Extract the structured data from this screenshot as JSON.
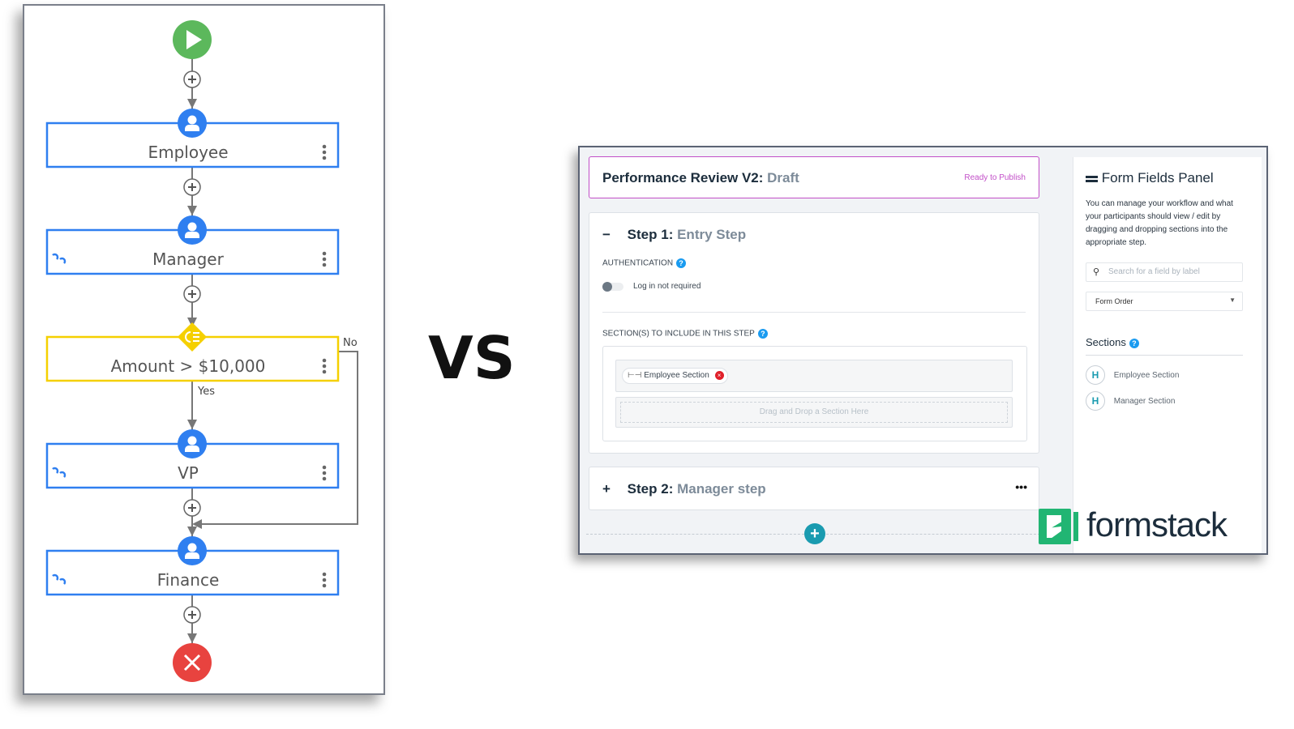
{
  "workflow": {
    "nodes": [
      {
        "label": "Employee",
        "type": "person",
        "linked": false
      },
      {
        "label": "Manager",
        "type": "person",
        "linked": true
      },
      {
        "label": "Amount > $10,000",
        "type": "condition",
        "linked": false
      },
      {
        "label": "VP",
        "type": "person",
        "linked": true
      },
      {
        "label": "Finance",
        "type": "person",
        "linked": true
      }
    ],
    "yes_label": "Yes",
    "no_label": "No",
    "colors": {
      "start": "#5cb85c",
      "end": "#e8433f",
      "person": "#2f7ff0",
      "condition": "#f5d000",
      "line": "#777777"
    }
  },
  "vs_label": "VS",
  "formstack": {
    "header": {
      "title": "Performance Review V2:",
      "status": "Draft",
      "publish_label": "Ready to Publish"
    },
    "step1": {
      "toggle_icon": "−",
      "title": "Step 1:",
      "name": "Entry Step",
      "auth_label": "AUTHENTICATION",
      "auth_value": "Log in not required",
      "sections_label": "SECTION(S) TO INCLUDE IN THIS STEP",
      "section_chip": "Employee Section",
      "drop_placeholder": "Drag and Drop a Section Here"
    },
    "step2": {
      "toggle_icon": "+",
      "title": "Step 2:",
      "name": "Manager step",
      "menu": "•••"
    },
    "panel": {
      "title": "Form Fields Panel",
      "description": "You can manage your workflow and what your participants should view / edit by dragging and dropping sections into the appropriate step.",
      "search_placeholder": "Search for a field by label",
      "sort_value": "Form Order",
      "sections_title": "Sections",
      "sections": [
        "Employee Section",
        "Manager Section"
      ]
    },
    "logo_text": "formstack",
    "colors": {
      "accent": "#c24fc8",
      "teal": "#1a9bb0",
      "brand": "#21b573"
    }
  }
}
